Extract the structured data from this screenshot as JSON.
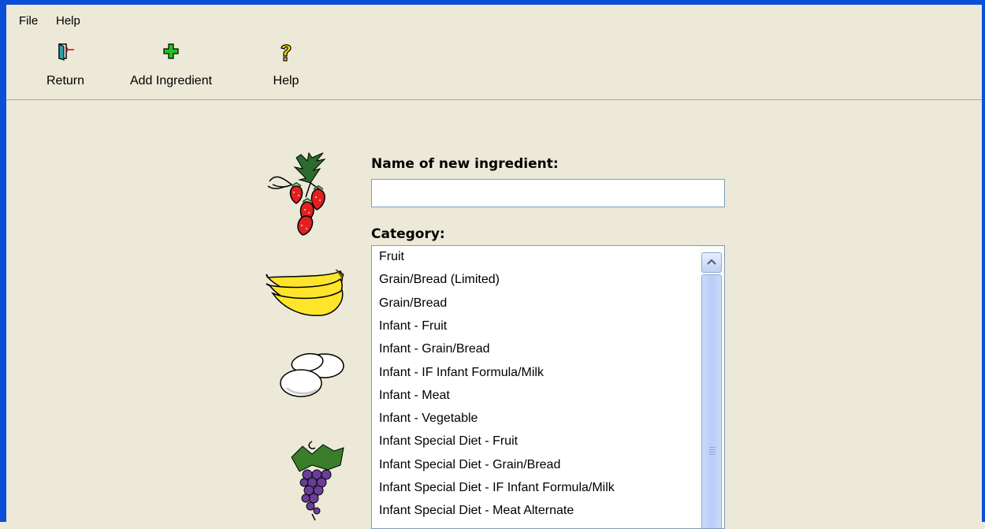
{
  "menu": {
    "file": "File",
    "help": "Help"
  },
  "toolbar": {
    "return_label": "Return",
    "add_ingredient_label": "Add Ingredient",
    "help_label": "Help"
  },
  "form": {
    "name_label": "Name of new ingredient:",
    "name_value": "",
    "category_label": "Category:",
    "categories": [
      "Fruit",
      "Grain/Bread (Limited)",
      "Grain/Bread",
      "Infant - Fruit",
      "Infant - Grain/Bread",
      "Infant - IF Infant Formula/Milk",
      "Infant - Meat",
      "Infant - Vegetable",
      "Infant Special Diet - Fruit",
      "Infant Special Diet - Grain/Bread",
      "Infant Special Diet - IF Infant Formula/Milk",
      "Infant Special Diet - Meat Alternate"
    ]
  },
  "colors": {
    "title_bar": "#0a4fd8",
    "window_bg": "#ece9d8",
    "field_border": "#7f9db9"
  }
}
